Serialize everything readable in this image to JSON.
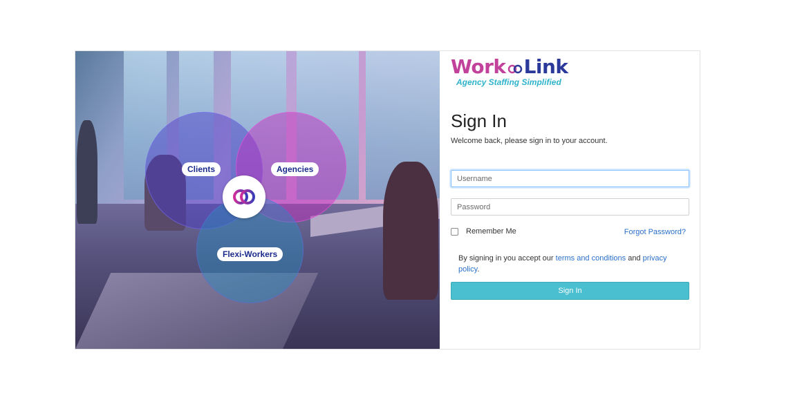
{
  "hero": {
    "labels": {
      "clients": "Clients",
      "agencies": "Agencies",
      "flexi_workers": "Flexi-Workers"
    },
    "center_icon": "worklink-symbol-icon"
  },
  "brand": {
    "word1": "Work",
    "word2": "Link",
    "tagline": "Agency Staffing Simplified",
    "colors": {
      "work": "#c2419a",
      "link": "#2b3a9a",
      "tagline": "#2fb3c9"
    }
  },
  "form": {
    "title": "Sign In",
    "subtitle": "Welcome back, please sign in to your account.",
    "username_placeholder": "Username",
    "password_placeholder": "Password",
    "remember_label": "Remember Me",
    "forgot_label": "Forgot Password?",
    "terms_prefix": "By signing in you accept our ",
    "terms_link": "terms and conditions",
    "terms_and": " and ",
    "privacy_link": "privacy policy",
    "terms_suffix": ".",
    "submit_label": "Sign In",
    "colors": {
      "button": "#49bfcf",
      "link": "#2a6fc9"
    }
  }
}
